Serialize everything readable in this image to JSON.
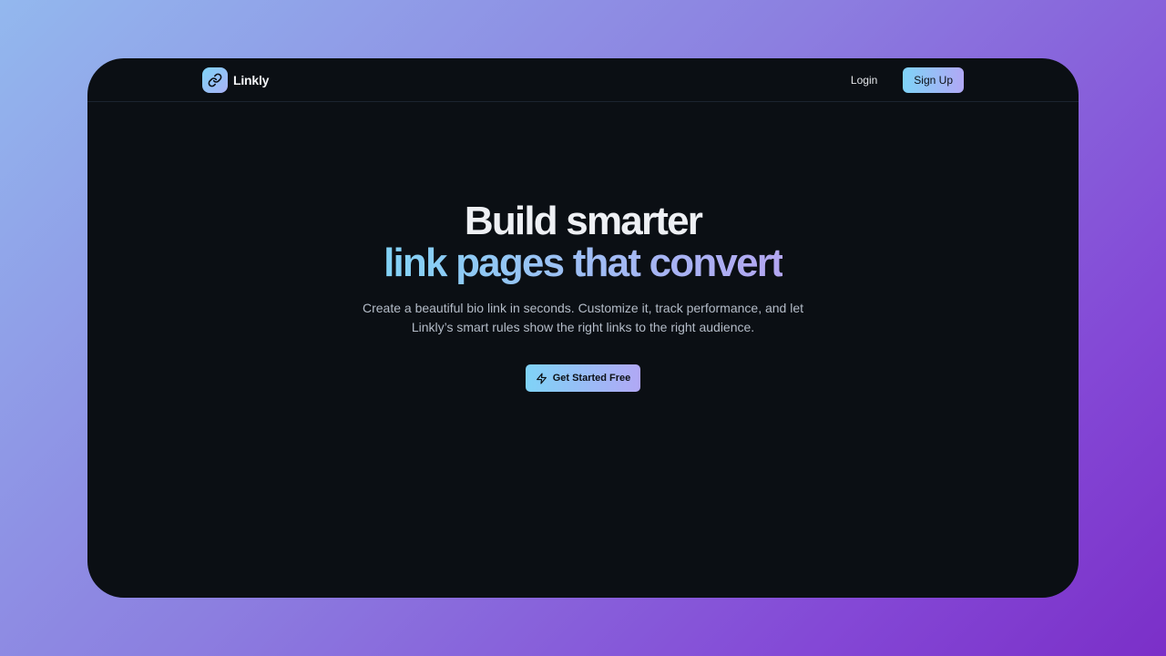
{
  "brand": {
    "name": "Linkly",
    "icon": "link-icon"
  },
  "nav": {
    "login_label": "Login",
    "signup_label": "Sign Up"
  },
  "hero": {
    "title_line1": "Build smarter",
    "title_line2": "link pages that convert",
    "subtitle": "Create a beautiful bio link in seconds. Customize it, track performance, and let Linkly’s smart rules show the right links to the right audience.",
    "cta_label": "Get Started Free",
    "cta_icon": "lightning-icon"
  },
  "colors": {
    "background_dark": "#0b0f14",
    "accent_start": "#7fd3f7",
    "accent_end": "#b1a8f5"
  }
}
